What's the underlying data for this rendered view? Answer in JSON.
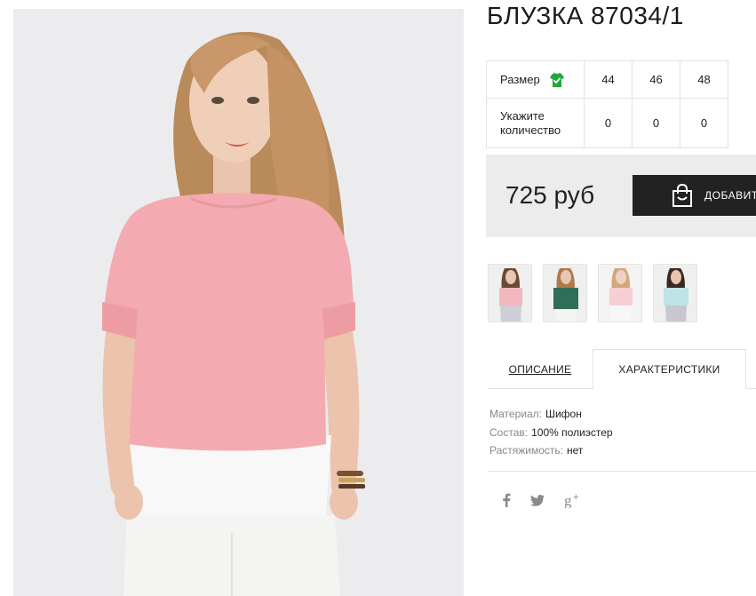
{
  "product": {
    "title": "БЛУЗКА 87034/1"
  },
  "sizes": {
    "size_label": "Размер",
    "qty_label_line1": "Укажите",
    "qty_label_line2": "количество",
    "values": [
      "44",
      "46",
      "48"
    ],
    "quantities": [
      "0",
      "0",
      "0"
    ]
  },
  "purchase": {
    "price": "725 руб",
    "cart_button": "ДОБАВИТ"
  },
  "thumbnails": [
    {
      "name": "pink-blouse",
      "color": "#f2b8be"
    },
    {
      "name": "green-blouse",
      "color": "#2f6f57"
    },
    {
      "name": "light-pink-blouse",
      "color": "#f6cfd3"
    },
    {
      "name": "mint-blouse",
      "color": "#bfe3e6"
    }
  ],
  "tabs": [
    {
      "label": "ОПИСАНИЕ",
      "active": false
    },
    {
      "label": "ХАРАКТЕРИСТИКИ",
      "active": true
    }
  ],
  "characteristics": [
    {
      "key": "Материал:",
      "value": "Шифон"
    },
    {
      "key": "Состав:",
      "value": "100% полиэстер"
    },
    {
      "key": "Растяжимость:",
      "value": "нет"
    }
  ],
  "social": [
    {
      "icon": "facebook-icon",
      "glyph": "f"
    },
    {
      "icon": "twitter-icon",
      "glyph": "t"
    },
    {
      "icon": "google-plus-icon",
      "glyph": "g+"
    }
  ],
  "colors": {
    "accent_green": "#1faa3a",
    "button_dark": "#222222",
    "price_bg": "#ececec"
  }
}
